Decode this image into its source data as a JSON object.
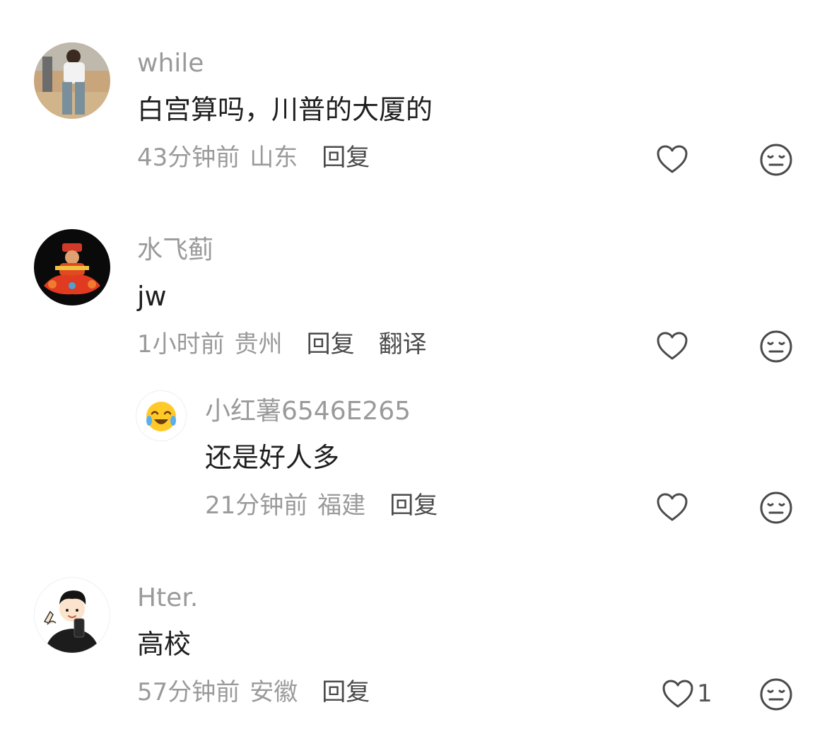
{
  "comments": [
    {
      "username": "while",
      "text": "白宫算吗，川普的大厦的",
      "time": "43分钟前",
      "location": "山东",
      "reply_label": "回复",
      "like_icon": "heart-outline-icon",
      "dislike_icon": "meh-face-icon"
    },
    {
      "username": "水飞蓟",
      "text": "jw",
      "time": "1小时前",
      "location": "贵州",
      "reply_label": "回复",
      "translate_label": "翻译",
      "like_icon": "heart-outline-icon",
      "dislike_icon": "meh-face-icon",
      "replies": [
        {
          "username": "小红薯6546E265",
          "text": "还是好人多",
          "time": "21分钟前",
          "location": "福建",
          "reply_label": "回复",
          "like_icon": "heart-outline-icon",
          "dislike_icon": "meh-face-icon"
        }
      ]
    },
    {
      "username": "Hter.",
      "text": "高校",
      "time": "57分钟前",
      "location": "安徽",
      "reply_label": "回复",
      "like_count": "1",
      "like_icon": "heart-outline-icon",
      "dislike_icon": "meh-face-icon"
    }
  ]
}
